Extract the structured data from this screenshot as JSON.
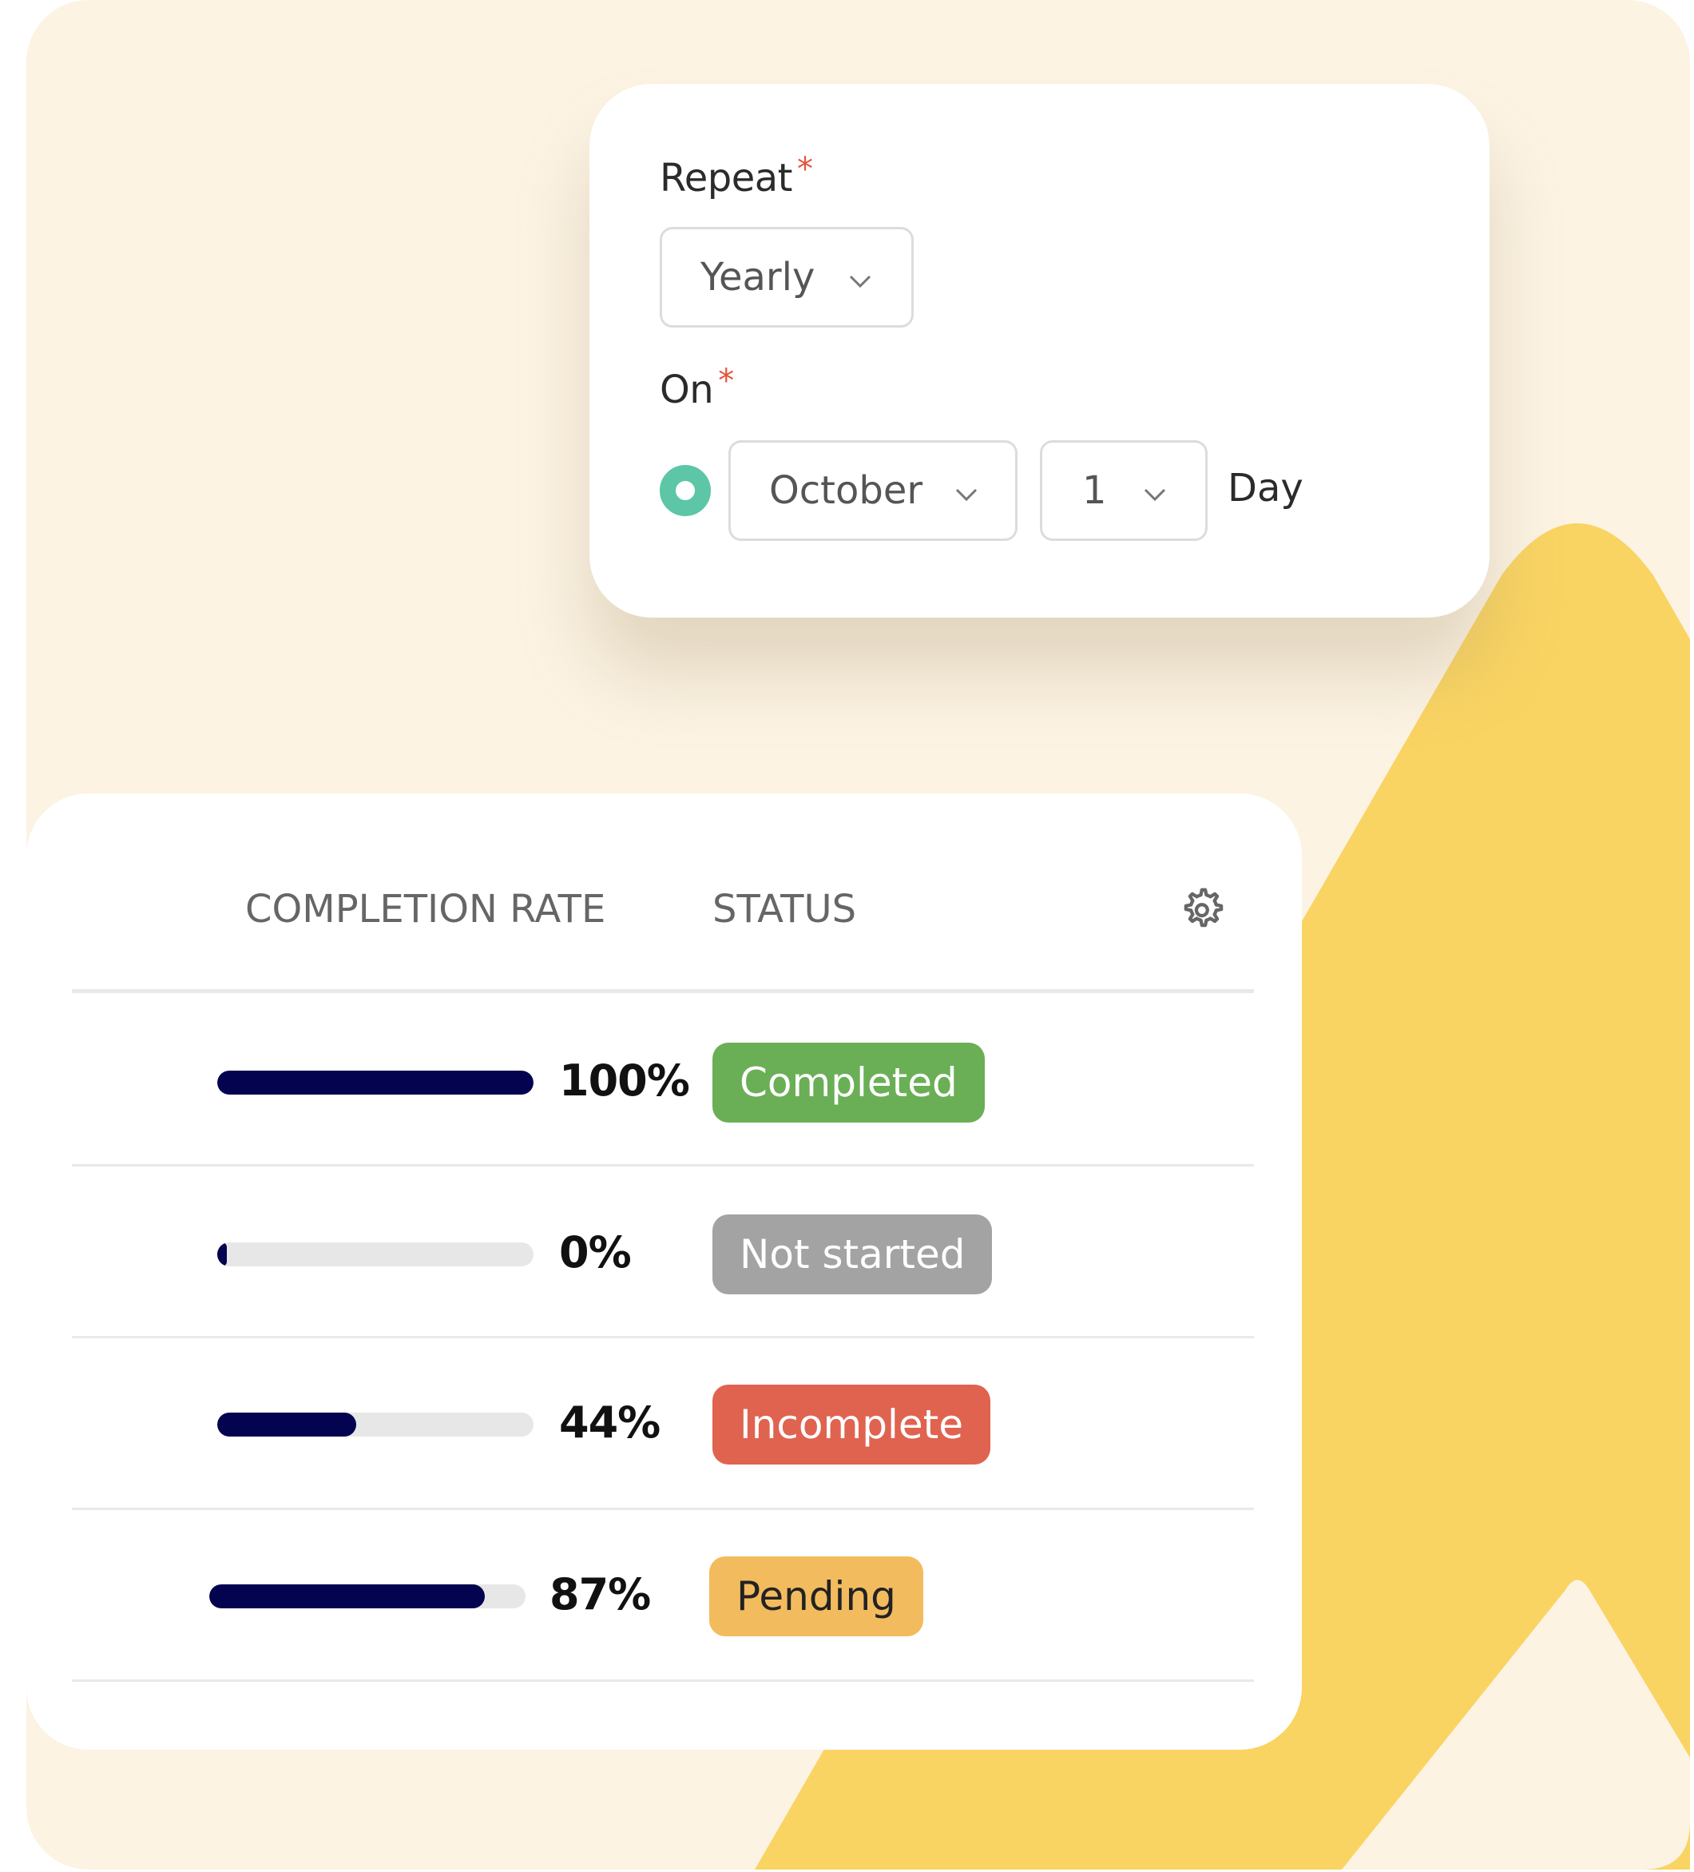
{
  "schedule": {
    "repeat_label": "Repeat",
    "repeat_required_marker": "*",
    "repeat_value": "Yearly",
    "on_label": "On",
    "on_required_marker": "*",
    "month_value": "October",
    "day_value": "1",
    "day_suffix": "Day",
    "radio_selected": true,
    "radio_color": "#5CC6A6"
  },
  "table": {
    "columns": [
      "COMPLETION RATE",
      "STATUS"
    ],
    "settings_icon": "gear-icon",
    "rows": [
      {
        "progress": 100,
        "percent_label": "100%",
        "status": "Completed",
        "status_color": "#6AAF56",
        "status_text_color": "#ffffff"
      },
      {
        "progress": 0,
        "percent_label": "0%",
        "status": "Not started",
        "status_color": "#A3A3A3",
        "status_text_color": "#ffffff"
      },
      {
        "progress": 44,
        "percent_label": "44%",
        "status": "Incomplete",
        "status_color": "#E0634F",
        "status_text_color": "#ffffff"
      },
      {
        "progress": 87,
        "percent_label": "87%",
        "status": "Pending",
        "status_color": "#F2BB5E",
        "status_text_color": "#222222"
      }
    ]
  },
  "colors": {
    "background": "#FCF3E3",
    "accent_yellow": "#F9D463",
    "progress_fill": "#03034F",
    "progress_track": "#E7E7E7"
  }
}
